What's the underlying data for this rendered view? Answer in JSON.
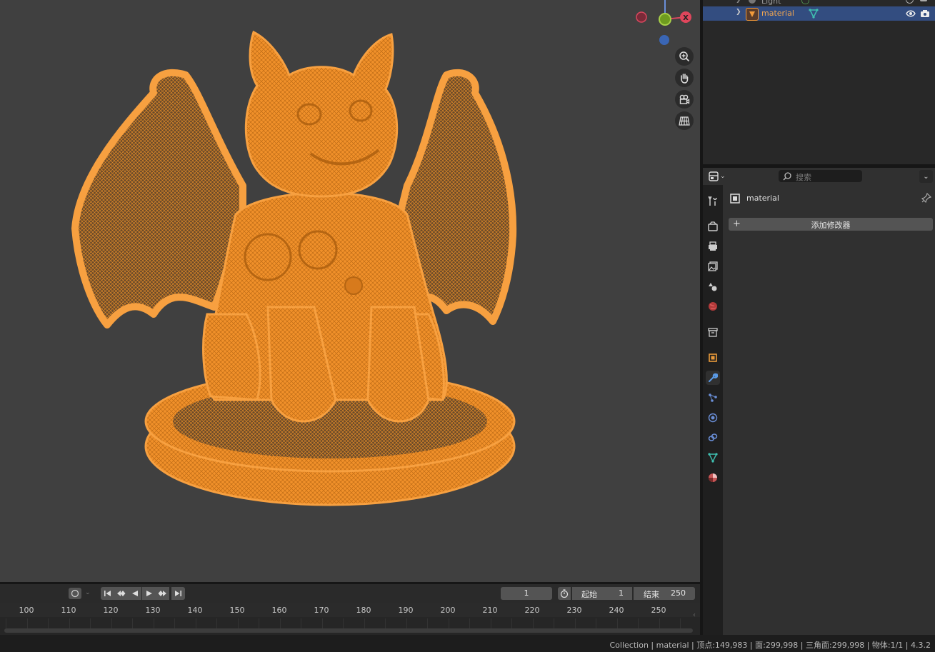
{
  "outliner": {
    "rows": [
      {
        "label": "Light"
      },
      {
        "label": "material"
      }
    ]
  },
  "properties": {
    "search_placeholder": "搜索",
    "object_name": "material",
    "add_modifier_label": "添加修改器",
    "tabs": [
      "tool",
      "render",
      "output",
      "view-layer",
      "scene",
      "world",
      "collection",
      "object",
      "modifiers",
      "particles",
      "physics",
      "constraints",
      "data",
      "material"
    ],
    "active_tab": "modifiers"
  },
  "viewport": {
    "gizmo_x_label": "X"
  },
  "timeline": {
    "current_frame": "1",
    "start_label": "起始",
    "start_value": "1",
    "end_label": "结束",
    "end_value": "250",
    "ticks": [
      "100",
      "110",
      "120",
      "130",
      "140",
      "150",
      "160",
      "170",
      "180",
      "190",
      "200",
      "210",
      "220",
      "230",
      "240",
      "250"
    ]
  },
  "status": {
    "text": "Collection | material | 顶点:149,983 | 面:299,998 | 三角面:299,998 | 物体:1/1 | 4.3.2"
  },
  "colors": {
    "selection": "#f5901e",
    "accent_blue": "#4772b3",
    "viewport_bg": "#404040"
  }
}
